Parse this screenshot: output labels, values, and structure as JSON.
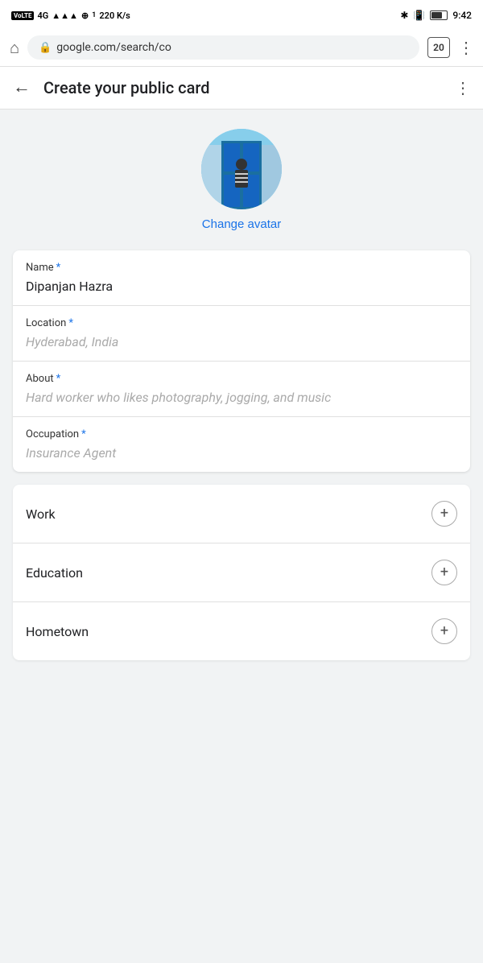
{
  "statusBar": {
    "carrier": "VoLTE",
    "network": "4G",
    "signal": "220 K/s",
    "time": "9:42",
    "tabCount": "20"
  },
  "browserBar": {
    "url": "google.com/search/co",
    "lockLabel": "🔒"
  },
  "header": {
    "title": "Create your public card",
    "backLabel": "←",
    "menuLabel": "⋮"
  },
  "avatar": {
    "changeLabel": "Change avatar"
  },
  "form": {
    "fields": [
      {
        "label": "Name",
        "required": true,
        "value": "Dipanjan Hazra",
        "placeholder": ""
      },
      {
        "label": "Location",
        "required": true,
        "value": "",
        "placeholder": "Hyderabad, India"
      },
      {
        "label": "About",
        "required": true,
        "value": "",
        "placeholder": "Hard worker who likes photography, jogging, and music"
      },
      {
        "label": "Occupation",
        "required": true,
        "value": "",
        "placeholder": "Insurance Agent"
      }
    ]
  },
  "expandSections": [
    {
      "label": "Work"
    },
    {
      "label": "Education"
    },
    {
      "label": "Hometown"
    }
  ]
}
